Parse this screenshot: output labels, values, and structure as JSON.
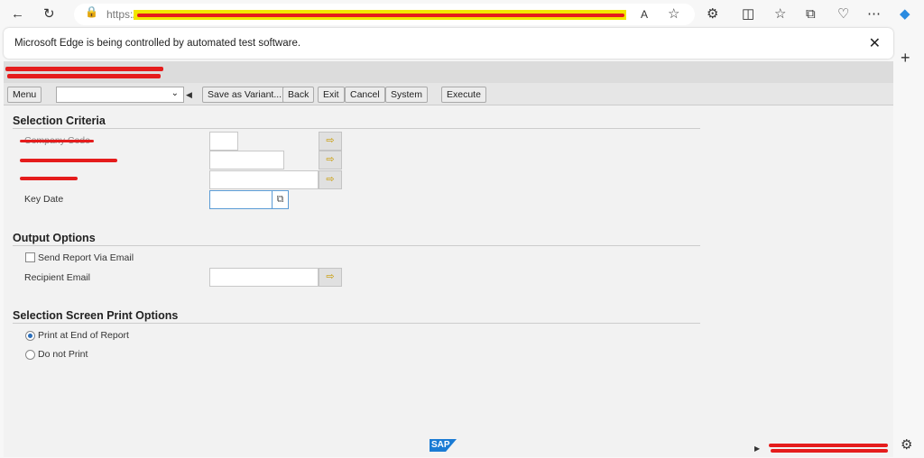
{
  "browser": {
    "url_prefix": "https://",
    "banner": "Microsoft Edge is being controlled by automated test software."
  },
  "toolbar": {
    "menu": "Menu",
    "variant_value": "",
    "save_variant": "Save as Variant...",
    "back": "Back",
    "exit": "Exit",
    "cancel": "Cancel",
    "system": "System",
    "execute": "Execute"
  },
  "selection": {
    "title": "Selection Criteria",
    "company_code": "Company Code",
    "key_date": "Key Date",
    "key_date_value": ""
  },
  "output": {
    "title": "Output Options",
    "send_email": "Send Report Via Email",
    "send_email_checked": false,
    "recipient_email": "Recipient Email",
    "recipient_value": ""
  },
  "print": {
    "title": "Selection Screen Print Options",
    "opt_end": "Print at End of Report",
    "opt_none": "Do not Print",
    "selected": "Print at End of Report"
  },
  "footer": {
    "logo": "SAP"
  }
}
